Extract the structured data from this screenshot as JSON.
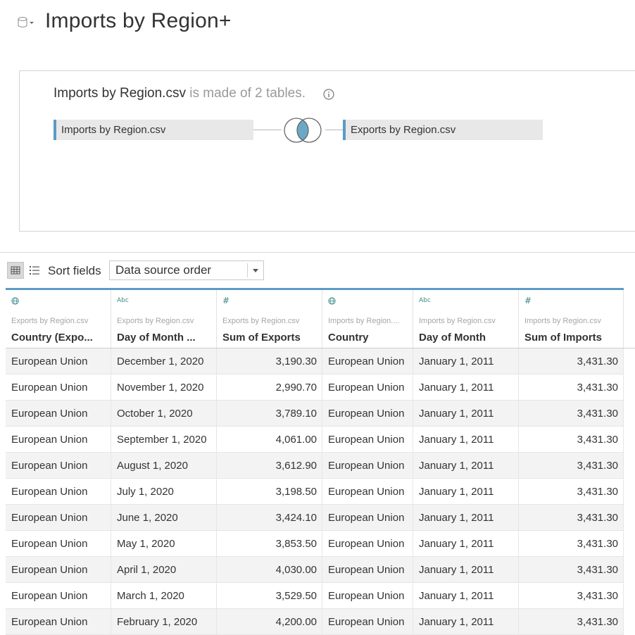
{
  "header": {
    "title": "Imports by Region+",
    "icon": "datasource-cylinder-icon"
  },
  "canvas": {
    "heading_name": "Imports by Region.csv",
    "heading_suffix": "is made of 2 tables.",
    "left_table": "Imports by Region.csv",
    "right_table": "Exports by Region.csv",
    "join_type": "inner-join-icon",
    "accent": "#5b9bc5"
  },
  "toolbar": {
    "sort_label": "Sort fields",
    "sort_value": "Data source order"
  },
  "grid": {
    "columns": [
      {
        "type": "globe",
        "source": "Exports by Region.csv",
        "name": "Country (Expo...",
        "align": "left"
      },
      {
        "type": "Abc",
        "source": "Exports by Region.csv",
        "name": "Day of Month ...",
        "align": "left"
      },
      {
        "type": "#",
        "source": "Exports by Region.csv",
        "name": "Sum of Exports",
        "align": "left"
      },
      {
        "type": "globe",
        "source": "Imports by Region....",
        "name": "Country",
        "align": "left"
      },
      {
        "type": "Abc",
        "source": "Imports by Region.csv",
        "name": "Day of Month",
        "align": "left"
      },
      {
        "type": "#",
        "source": "Imports by Region.csv",
        "name": "Sum of Imports",
        "align": "left"
      }
    ],
    "rows": [
      [
        "European Union",
        "December 1, 2020",
        "3,190.30",
        "European Union",
        "January 1, 2011",
        "3,431.30"
      ],
      [
        "European Union",
        "November 1, 2020",
        "2,990.70",
        "European Union",
        "January 1, 2011",
        "3,431.30"
      ],
      [
        "European Union",
        "October 1, 2020",
        "3,789.10",
        "European Union",
        "January 1, 2011",
        "3,431.30"
      ],
      [
        "European Union",
        "September 1, 2020",
        "4,061.00",
        "European Union",
        "January 1, 2011",
        "3,431.30"
      ],
      [
        "European Union",
        "August 1, 2020",
        "3,612.90",
        "European Union",
        "January 1, 2011",
        "3,431.30"
      ],
      [
        "European Union",
        "July 1, 2020",
        "3,198.50",
        "European Union",
        "January 1, 2011",
        "3,431.30"
      ],
      [
        "European Union",
        "June 1, 2020",
        "3,424.10",
        "European Union",
        "January 1, 2011",
        "3,431.30"
      ],
      [
        "European Union",
        "May 1, 2020",
        "3,853.50",
        "European Union",
        "January 1, 2011",
        "3,431.30"
      ],
      [
        "European Union",
        "April 1, 2020",
        "4,030.00",
        "European Union",
        "January 1, 2011",
        "3,431.30"
      ],
      [
        "European Union",
        "March 1, 2020",
        "3,529.50",
        "European Union",
        "January 1, 2011",
        "3,431.30"
      ],
      [
        "European Union",
        "February 1, 2020",
        "4,200.00",
        "European Union",
        "January 1, 2011",
        "3,431.30"
      ]
    ]
  }
}
